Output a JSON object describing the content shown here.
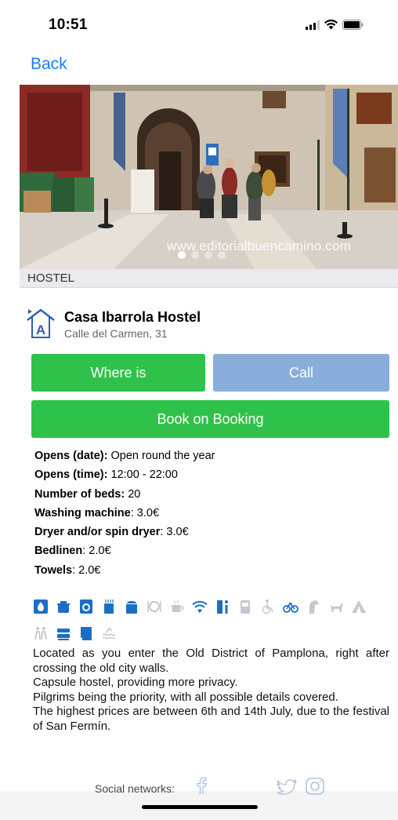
{
  "status_bar": {
    "time": "10:51"
  },
  "nav": {
    "back_label": "Back"
  },
  "hero": {
    "watermark": "www.editorialbuencamino.com",
    "page_count": 4,
    "active_page": 1
  },
  "category": {
    "label": "HOSTEL"
  },
  "hostel": {
    "name": "Casa Ibarrola Hostel",
    "address": "Calle del Carmen, 31"
  },
  "actions": {
    "where_label": "Where is",
    "call_label": "Call",
    "book_label": "Book on Booking"
  },
  "colors": {
    "accent_green": "#2ec24a",
    "call_blue": "#89aedb",
    "link_blue": "#1e7cf2",
    "amenity_blue": "#1a6fc4",
    "amenity_gray": "#c2c8cf"
  },
  "details": [
    {
      "label": "Opens (date):",
      "value": " Open round the year"
    },
    {
      "label": "Opens (time):",
      "value": " 12:00 - 22:00"
    },
    {
      "label": "Number of beds:",
      "value": " 20"
    },
    {
      "label": "Washing machine",
      "value": ": 3.0€"
    },
    {
      "label": "Dryer and/or spin dryer",
      "value": ": 3.0€"
    },
    {
      "label": "Bedlinen",
      "value": ": 2.0€"
    },
    {
      "label": "Towels",
      "value": ": 2.0€"
    }
  ],
  "amenities": {
    "row1": [
      {
        "icon": "water-drop-icon",
        "active": true
      },
      {
        "icon": "cooking-pot-icon",
        "active": true
      },
      {
        "icon": "washing-machine-icon",
        "active": true
      },
      {
        "icon": "dryer-icon",
        "active": true
      },
      {
        "icon": "kitchen-icon",
        "active": true
      },
      {
        "icon": "restaurant-icon",
        "active": false
      },
      {
        "icon": "breakfast-icon",
        "active": false
      },
      {
        "icon": "wifi-icon",
        "active": true
      },
      {
        "icon": "info-point-icon",
        "active": true
      },
      {
        "icon": "vending-icon",
        "active": false
      },
      {
        "icon": "wheelchair-icon",
        "active": false
      },
      {
        "icon": "bicycle-icon",
        "active": true
      },
      {
        "icon": "horse-icon",
        "active": false
      },
      {
        "icon": "pets-icon",
        "active": false
      },
      {
        "icon": "tent-icon",
        "active": false
      }
    ],
    "row2": [
      {
        "icon": "pilgrims-icon",
        "active": false
      },
      {
        "icon": "lockers-icon",
        "active": true
      },
      {
        "icon": "towel-icon",
        "active": true
      },
      {
        "icon": "pool-icon",
        "active": false
      }
    ]
  },
  "description": {
    "p1": "Located as you enter the Old District of Pamplona, right after crossing the old city walls.",
    "p2": "Capsule hostel, providing more privacy.",
    "p3": "Pilgrims being the priority, with all possible details covered.",
    "p4": "The highest prices are between 6th and 14th July, due to the festival of San Fermín."
  },
  "social": {
    "label": "Social networks:"
  }
}
